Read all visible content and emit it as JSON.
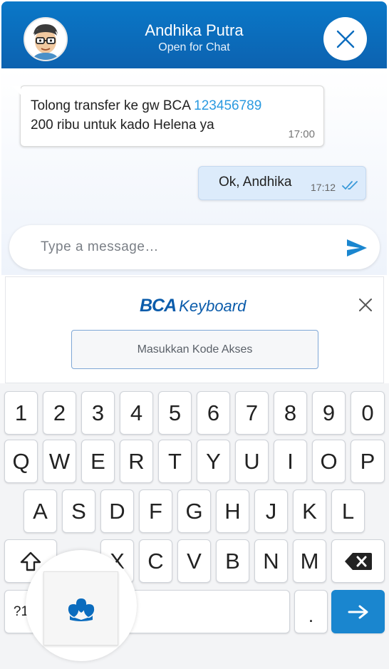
{
  "header": {
    "title": "Andhika Putra",
    "subtitle": "Open for Chat",
    "avatar_icon": "avatar-glasses-icon",
    "close_icon": "close-icon",
    "brand_color": "#0b6cbe"
  },
  "messages": [
    {
      "direction": "incoming",
      "line1_prefix": "Tolong transfer ke gw BCA ",
      "account_number": "123456789",
      "line2": "200 ribu untuk kado Helena ya",
      "time": "17:00"
    },
    {
      "direction": "outgoing",
      "text": "Ok, Andhika",
      "time": "17:12",
      "status_icon": "double-check-icon"
    }
  ],
  "composer": {
    "placeholder": "Type a message…",
    "send_icon": "send-icon"
  },
  "bca_keyboard": {
    "logo_bold": "BCA",
    "logo_text": "Keyboard",
    "close_icon": "close-icon",
    "access_code_placeholder": "Masukkan Kode Akses"
  },
  "keyboard": {
    "row_numbers": [
      "1",
      "2",
      "3",
      "4",
      "5",
      "6",
      "7",
      "8",
      "9",
      "0"
    ],
    "row_top": [
      "Q",
      "W",
      "E",
      "R",
      "T",
      "Y",
      "U",
      "I",
      "O",
      "P"
    ],
    "row_home": [
      "A",
      "S",
      "D",
      "F",
      "G",
      "H",
      "J",
      "K",
      "L"
    ],
    "row_bottom": [
      "X",
      "C",
      "V",
      "B",
      "N",
      "M"
    ],
    "symbols_key": "?1",
    "period_key": ".",
    "shift_icon": "shift-icon",
    "backspace_icon": "backspace-icon",
    "enter_icon": "arrow-right-icon",
    "logo_icon": "bca-logo-icon",
    "accent_color": "#1a86cf"
  }
}
